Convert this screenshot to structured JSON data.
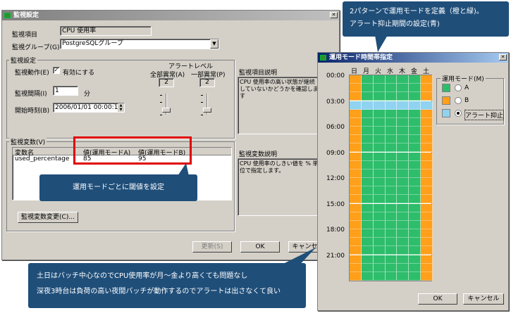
{
  "main_window": {
    "title": "監視設定",
    "item_label": "監視項目",
    "item_value": "CPU 使用率",
    "group_label": "監視グループ(G)",
    "group_value": "PostgreSQLグループ",
    "settings_group": "監視設定",
    "action_label": "監視動作(E)",
    "enable_label": "有効にする",
    "interval_label": "監視間隔(I)",
    "interval_value": "1",
    "interval_unit": "分",
    "start_label": "開始時刻(B)",
    "start_value": "2006/01/01 00:00:10",
    "alert_level_label": "アラートレベル",
    "all_error_label": "全部異常(A)",
    "partial_error_label": "一部異常(P)",
    "all_error_value": "2",
    "partial_error_value": "2",
    "item_desc_label": "監視項目説明",
    "item_desc_text": "CPU 使用率の高い状態が継続していないかどうかを確認します",
    "variables_group": "監視変数(V)",
    "col_name": "変数名",
    "col_value_a": "値(運用モードA)",
    "col_value_b": "値(運用モードB)",
    "row_name": "used_percentage",
    "row_value_a": "85",
    "row_value_b": "95",
    "var_desc_label": "監視変数説明",
    "var_desc_text": "CPU 使用率のしきい値を % 単位で指定します。",
    "change_button": "監視変数変更(C)...",
    "update_button": "更新(S)",
    "ok_button": "OK",
    "cancel_button": "キャンセル"
  },
  "schedule_window": {
    "title": "運用モード時間帯指定",
    "days": [
      "日",
      "月",
      "火",
      "水",
      "木",
      "金",
      "土"
    ],
    "times": [
      "00:00",
      "03:00",
      "06:00",
      "09:00",
      "12:00",
      "15:00",
      "18:00",
      "21:00"
    ],
    "mode_group": "運用モード(M)",
    "modes": [
      {
        "label": "A",
        "color": "#2ebd6b"
      },
      {
        "label": "B",
        "color": "#ff9f1a"
      },
      {
        "label": "アラート抑止",
        "color": "#8fd3f0"
      }
    ],
    "selected_mode": "アラート抑止",
    "ok_button": "OK",
    "cancel_button": "キャンセル"
  },
  "callouts": {
    "top_right": "2パターンで運用モードを定義（橙と緑)。\nアラート抑止期間の設定(青)",
    "threshold": "運用モードごとに閾値を設定",
    "bottom_line1": "土日はバッチ中心なのでCPU使用率が月～金より高くても問題なし",
    "bottom_line2": "深夜3時台は負荷の高い夜間バッチが動作するのでアラートは出さなくて良い"
  },
  "colors": {
    "weekend": "#ff9f1a",
    "weekday": "#2ebd6b",
    "suppress": "#8fd3f0",
    "callout": "#1f4e79",
    "highlight": "#e00000"
  }
}
